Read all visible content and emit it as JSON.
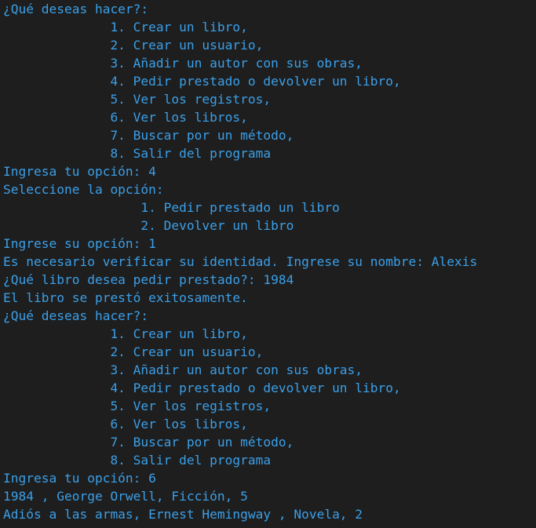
{
  "terminal": {
    "lines": [
      "¿Qué deseas hacer?:",
      "              1. Crear un libro,",
      "              2. Crear un usuario,",
      "              3. Añadir un autor con sus obras,",
      "              4. Pedir prestado o devolver un libro,",
      "              5. Ver los registros,",
      "              6. Ver los libros,",
      "              7. Buscar por un método,",
      "              8. Salir del programa",
      "Ingresa tu opción: 4",
      "Seleccione la opción:",
      "                  1. Pedir prestado un libro",
      "                  2. Devolver un libro",
      "Ingrese su opción: 1",
      "Es necesario verificar su identidad. Ingrese su nombre: Alexis",
      "¿Qué libro desea pedir prestado?: 1984",
      "El libro se prestó exitosamente.",
      "¿Qué deseas hacer?:",
      "              1. Crear un libro,",
      "              2. Crear un usuario,",
      "              3. Añadir un autor con sus obras,",
      "              4. Pedir prestado o devolver un libro,",
      "              5. Ver los registros,",
      "              6. Ver los libros,",
      "              7. Buscar por un método,",
      "              8. Salir del programa",
      "Ingresa tu opción: 6",
      "1984 , George Orwell, Ficción, 5",
      "Adiós a las armas, Ernest Hemingway , Novela, 2",
      "  "
    ]
  }
}
